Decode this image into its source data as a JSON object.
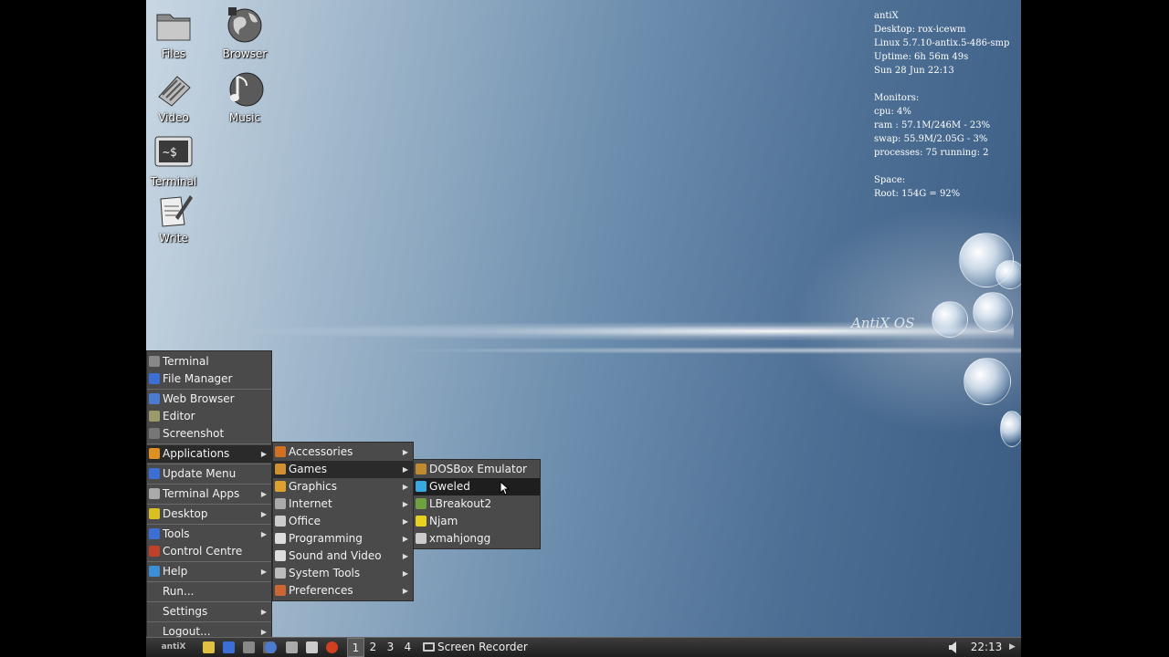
{
  "desktop": {
    "icons": [
      {
        "label": "Files",
        "icon": "folder-icon"
      },
      {
        "label": "Browser",
        "icon": "globe-icon"
      },
      {
        "label": "Video",
        "icon": "film-icon"
      },
      {
        "label": "Music",
        "icon": "music-note-icon"
      },
      {
        "label": "Terminal",
        "icon": "terminal-icon",
        "glyph_text": "~$"
      },
      {
        "label": "Write",
        "icon": "pencil-paper-icon"
      }
    ],
    "watermark": "AntiX OS"
  },
  "conky": {
    "lines": [
      "antiX",
      "Desktop: rox-icewm",
      "Linux 5.7.10-antix.5-486-smp",
      "Uptime: 6h 56m 49s",
      "Sun 28 Jun 22:13",
      "",
      "Monitors:",
      "cpu: 4%",
      "ram : 57.1M/246M - 23%",
      "swap: 55.9M/2.05G - 3%",
      "processes: 75 running: 2",
      "",
      "Space:",
      "Root: 154G = 92%"
    ]
  },
  "main_menu": {
    "items": [
      {
        "label": "Terminal",
        "icon": "terminal-icon",
        "color": "#888888"
      },
      {
        "label": "File Manager",
        "icon": "file-manager-icon",
        "color": "#3b6fd6"
      },
      {
        "label": "Web Browser",
        "icon": "browser-icon",
        "color": "#4a7bd0"
      },
      {
        "label": "Editor",
        "icon": "editor-icon",
        "color": "#9a9a6a"
      },
      {
        "label": "Screenshot",
        "icon": "camera-icon",
        "color": "#777777"
      },
      {
        "label": "Applications",
        "icon": "applications-icon",
        "color": "#e09020",
        "submenu": true
      },
      {
        "label": "Update Menu",
        "icon": "refresh-icon",
        "color": "#3b6fd6"
      },
      {
        "label": "Terminal Apps",
        "icon": "terminal-apps-icon",
        "color": "#aaaaaa",
        "submenu": true
      },
      {
        "label": "Desktop",
        "icon": "desktop-icon",
        "color": "#d8c020",
        "submenu": true
      },
      {
        "label": "Tools",
        "icon": "tools-icon",
        "color": "#3b6fd6",
        "submenu": true
      },
      {
        "label": "Control Centre",
        "icon": "control-centre-icon",
        "color": "#c0402a"
      },
      {
        "label": "Help",
        "icon": "help-icon",
        "color": "#3b8fd6",
        "submenu": true
      },
      {
        "label": "Run...",
        "icon": "",
        "color": ""
      },
      {
        "label": "Settings",
        "icon": "",
        "color": "",
        "submenu": true
      },
      {
        "label": "Logout...",
        "icon": "",
        "color": "",
        "submenu": true
      }
    ]
  },
  "applications_menu": {
    "items": [
      {
        "label": "Accessories",
        "icon": "accessories-icon",
        "color": "#d07020"
      },
      {
        "label": "Games",
        "icon": "games-icon",
        "color": "#d09030"
      },
      {
        "label": "Graphics",
        "icon": "graphics-icon",
        "color": "#e0a030"
      },
      {
        "label": "Internet",
        "icon": "internet-icon",
        "color": "#aaaaaa"
      },
      {
        "label": "Office",
        "icon": "office-icon",
        "color": "#cccccc"
      },
      {
        "label": "Programming",
        "icon": "programming-icon",
        "color": "#dddddd"
      },
      {
        "label": "Sound and Video",
        "icon": "sound-video-icon",
        "color": "#dddddd"
      },
      {
        "label": "System Tools",
        "icon": "system-tools-icon",
        "color": "#bbbbbb"
      },
      {
        "label": "Preferences",
        "icon": "preferences-icon",
        "color": "#cc6633"
      }
    ]
  },
  "games_menu": {
    "items": [
      {
        "label": "DOSBox Emulator",
        "icon": "dosbox-icon",
        "color": "#c08a30"
      },
      {
        "label": "Gweled",
        "icon": "gem-icon",
        "color": "#38a8e0"
      },
      {
        "label": "LBreakout2",
        "icon": "lbreakout-icon",
        "color": "#70a040"
      },
      {
        "label": "Njam",
        "icon": "njam-icon",
        "color": "#e8d020"
      },
      {
        "label": "xmahjongg",
        "icon": "mahjongg-icon",
        "color": "#cccccc"
      }
    ]
  },
  "taskbar": {
    "start_label": "antiX",
    "workspaces": [
      "1",
      "2",
      "3",
      "4"
    ],
    "task_label": "Screen Recorder",
    "clock": "22:13"
  }
}
